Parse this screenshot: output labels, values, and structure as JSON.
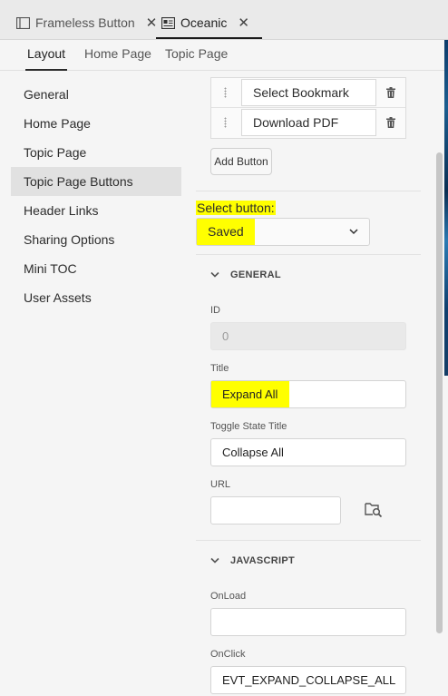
{
  "doc_tabs": [
    {
      "label": "Frameless Button",
      "icon": "window-icon",
      "close": "✕"
    },
    {
      "label": "Oceanic",
      "icon": "layout-icon",
      "close": "✕"
    }
  ],
  "sub_tabs": [
    "Layout",
    "Home Page",
    "Topic Page"
  ],
  "nav": {
    "items": [
      "General",
      "Home Page",
      "Topic Page",
      "Topic Page Buttons",
      "Header Links",
      "Sharing Options",
      "Mini TOC",
      "User Assets"
    ],
    "selected": "Topic Page Buttons"
  },
  "button_list": {
    "items": [
      "Select Bookmark",
      "Download PDF"
    ],
    "add_label": "Add Button"
  },
  "select_button": {
    "label": "Select button:",
    "value": "Saved"
  },
  "general": {
    "heading": "GENERAL",
    "id_label": "ID",
    "id_value": "0",
    "title_label": "Title",
    "title_value": "Expand All",
    "toggle_label": "Toggle State Title",
    "toggle_value": "Collapse All",
    "url_label": "URL",
    "url_value": ""
  },
  "javascript": {
    "heading": "JAVASCRIPT",
    "onload_label": "OnLoad",
    "onload_value": "",
    "onclick_label": "OnClick",
    "onclick_value": "EVT_EXPAND_COLLAPSE_ALL"
  },
  "colors": {
    "highlight": "#ffff00",
    "selected_nav": "#e1e1e1"
  }
}
